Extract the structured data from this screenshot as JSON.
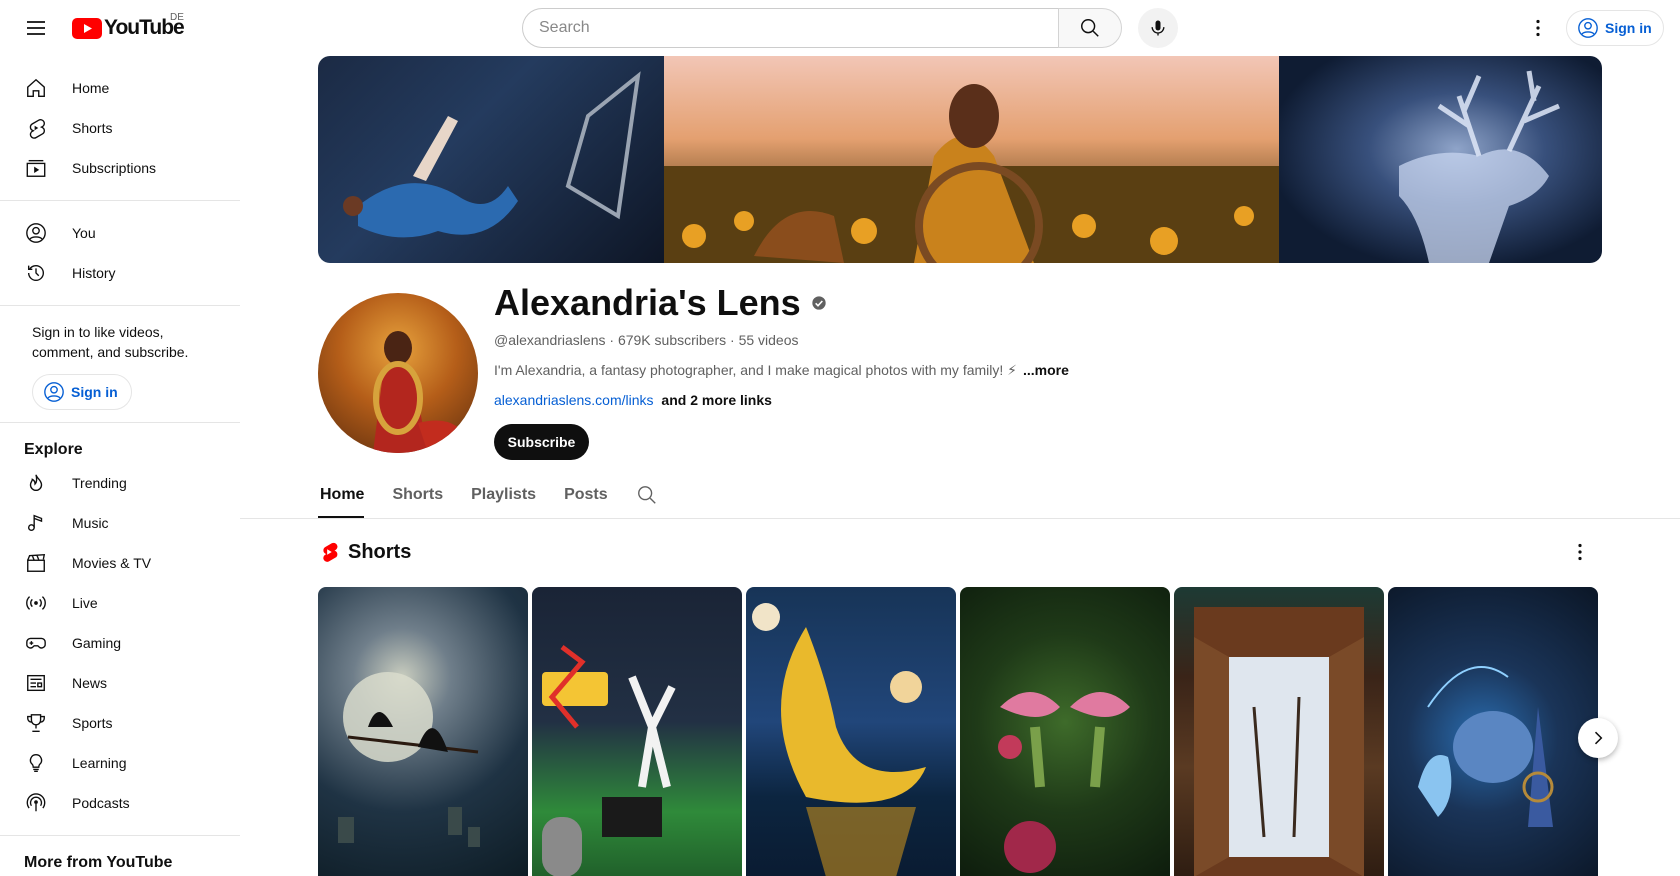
{
  "header": {
    "logo_text": "YouTube",
    "region": "DE",
    "search_placeholder": "Search",
    "signin_label": "Sign in",
    "accent_color": "#ff0000",
    "link_color": "#065fd4"
  },
  "sidebar": {
    "main": [
      {
        "label": "Home",
        "icon": "home-icon"
      },
      {
        "label": "Shorts",
        "icon": "shorts-icon"
      },
      {
        "label": "Subscriptions",
        "icon": "subscriptions-icon"
      }
    ],
    "you": [
      {
        "label": "You",
        "icon": "you-icon"
      },
      {
        "label": "History",
        "icon": "history-icon"
      }
    ],
    "signin_note": "Sign in to like videos, comment, and subscribe.",
    "signin_label": "Sign in",
    "explore_title": "Explore",
    "explore": [
      {
        "label": "Trending",
        "icon": "trending-icon"
      },
      {
        "label": "Music",
        "icon": "music-icon"
      },
      {
        "label": "Movies & TV",
        "icon": "movies-icon"
      },
      {
        "label": "Live",
        "icon": "live-icon"
      },
      {
        "label": "Gaming",
        "icon": "gaming-icon"
      },
      {
        "label": "News",
        "icon": "news-icon"
      },
      {
        "label": "Sports",
        "icon": "sports-icon"
      },
      {
        "label": "Learning",
        "icon": "learning-icon"
      },
      {
        "label": "Podcasts",
        "icon": "podcasts-icon"
      }
    ],
    "more_title": "More from YouTube"
  },
  "channel": {
    "name": "Alexandria's Lens",
    "verified": true,
    "handle": "@alexandriaslens",
    "subscribers": "679K subscribers",
    "videos": "55 videos",
    "description": "I'm Alexandria, a fantasy photographer, and I make magical photos with my family! ⚡",
    "more_label": "...more",
    "link": "alexandriaslens.com/links",
    "more_links": "and 2 more links",
    "subscribe_label": "Subscribe"
  },
  "tabs": [
    "Home",
    "Shorts",
    "Playlists",
    "Posts"
  ],
  "active_tab": "Home",
  "shorts_section": {
    "title": "Shorts",
    "items": [
      {
        "theme": "witches-flying-moon"
      },
      {
        "theme": "betelgeuse-sign"
      },
      {
        "theme": "girl-on-crescent-moon"
      },
      {
        "theme": "fairies-flowers"
      },
      {
        "theme": "wardrobe-snow-portal"
      },
      {
        "theme": "cinderella-pumpkin"
      }
    ]
  }
}
